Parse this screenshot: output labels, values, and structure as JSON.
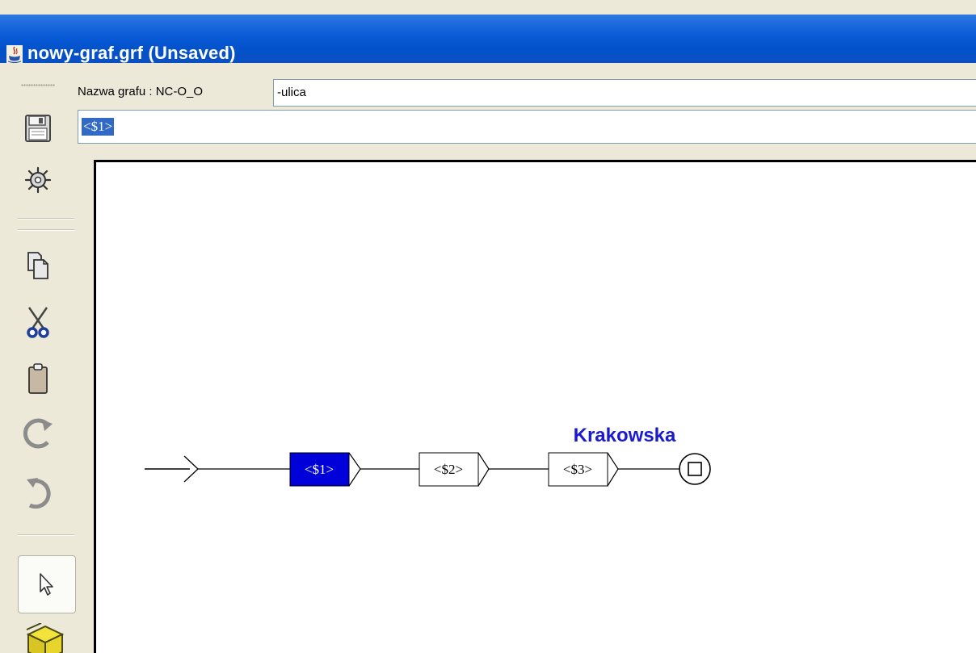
{
  "window": {
    "title": "nowy-graf.grf (Unsaved)"
  },
  "toolbar": {
    "tools": [
      "save-icon",
      "compile-icon",
      "copy-icon",
      "cut-icon",
      "paste-icon",
      "redo-icon",
      "undo-icon",
      "select-arrow-icon",
      "package-icon"
    ]
  },
  "graph_name": {
    "label": "Nazwa grafu : NC-O_O",
    "value": "-ulica"
  },
  "box_editor": {
    "value": "<$1>"
  },
  "graph": {
    "boxes": [
      {
        "label": "<$1>",
        "selected": true
      },
      {
        "label": "<$2>",
        "selected": false
      },
      {
        "label": "<$3>",
        "selected": false
      }
    ],
    "output_label": "Krakowska",
    "selected_color": "#0000d8",
    "output_color": "#1a1ad0"
  }
}
